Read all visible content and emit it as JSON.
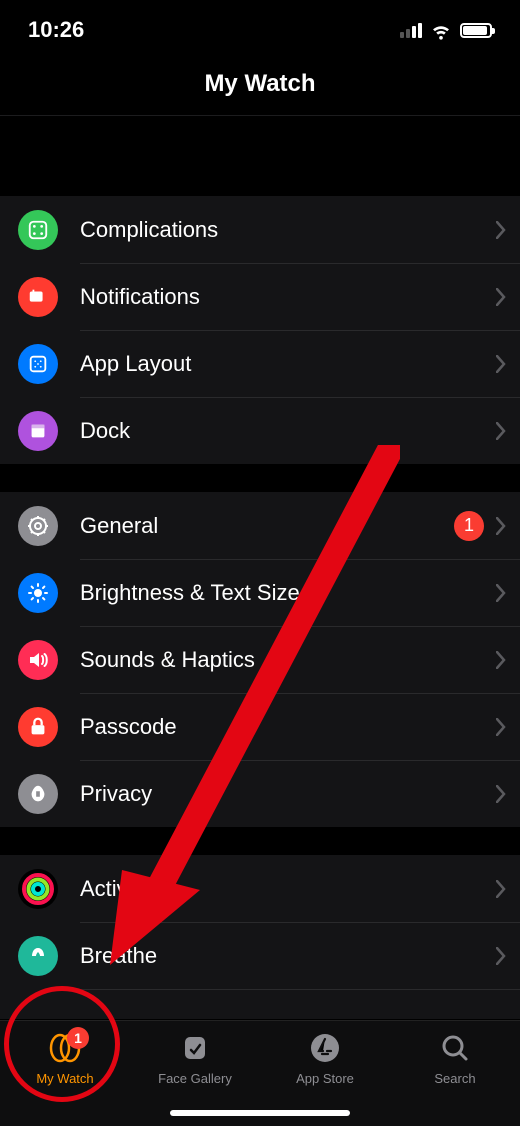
{
  "status": {
    "time": "10:26"
  },
  "nav": {
    "title": "My Watch"
  },
  "section1": {
    "items": [
      {
        "label": "Complications",
        "icon": "complications-icon",
        "color": "#34c759"
      },
      {
        "label": "Notifications",
        "icon": "notifications-icon",
        "color": "#ff3b30"
      },
      {
        "label": "App Layout",
        "icon": "applayout-icon",
        "color": "#007aff"
      },
      {
        "label": "Dock",
        "icon": "dock-icon",
        "color": "#af52de"
      }
    ]
  },
  "section2": {
    "items": [
      {
        "label": "General",
        "icon": "general-icon",
        "color": "#8e8e93",
        "badge": "1"
      },
      {
        "label": "Brightness & Text Size",
        "icon": "brightness-icon",
        "color": "#007aff"
      },
      {
        "label": "Sounds & Haptics",
        "icon": "sounds-icon",
        "color": "#ff2d55"
      },
      {
        "label": "Passcode",
        "icon": "passcode-icon",
        "color": "#ff3b30"
      },
      {
        "label": "Privacy",
        "icon": "privacy-icon",
        "color": "#8e8e93"
      }
    ]
  },
  "section3": {
    "items": [
      {
        "label": "Activity",
        "icon": "activity-icon",
        "color": "#000"
      },
      {
        "label": "Breathe",
        "icon": "breathe-icon",
        "color": "#00c7a3"
      }
    ]
  },
  "tabs": {
    "items": [
      {
        "label": "My Watch",
        "badge": "1",
        "active": true
      },
      {
        "label": "Face Gallery"
      },
      {
        "label": "App Store"
      },
      {
        "label": "Search"
      }
    ]
  }
}
